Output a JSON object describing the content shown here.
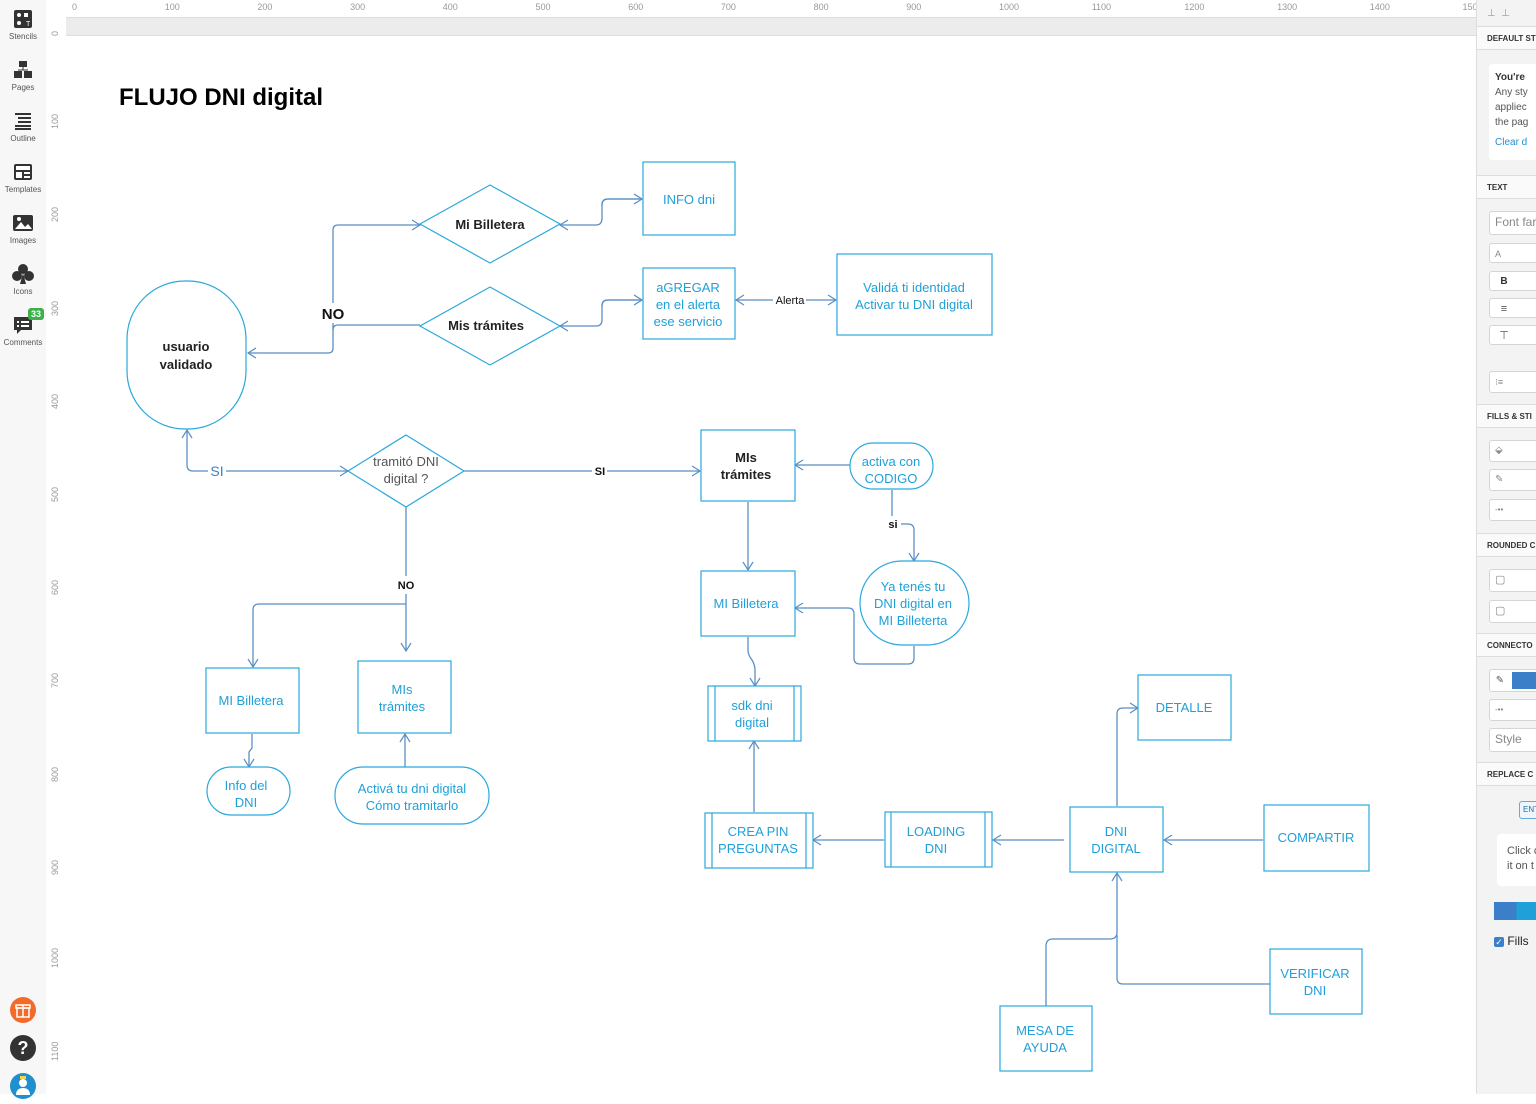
{
  "left_toolbar": {
    "items": [
      {
        "label": "Stencils",
        "icon": "stencils-icon"
      },
      {
        "label": "Pages",
        "icon": "pages-icon"
      },
      {
        "label": "Outline",
        "icon": "outline-icon"
      },
      {
        "label": "Templates",
        "icon": "templates-icon"
      },
      {
        "label": "Images",
        "icon": "images-icon"
      },
      {
        "label": "Icons",
        "icon": "club-icon"
      },
      {
        "label": "Comments",
        "icon": "comments-icon",
        "badge": "33"
      }
    ],
    "bottom": [
      {
        "icon": "gift-icon",
        "color": "#f26b2a"
      },
      {
        "icon": "help-icon",
        "label": "?",
        "color": "#333333"
      },
      {
        "icon": "avatar-icon",
        "color": "#1f8fd0"
      }
    ]
  },
  "rulers": {
    "horizontal": [
      "0",
      "100",
      "200",
      "300",
      "400",
      "500",
      "600",
      "700",
      "800",
      "900",
      "1000",
      "1100",
      "1200",
      "1300",
      "1400",
      "150"
    ],
    "vertical": [
      "0",
      "100",
      "200",
      "300",
      "400",
      "500",
      "600",
      "700",
      "800",
      "900",
      "1000",
      "1100"
    ]
  },
  "diagram": {
    "title": "FLUJO  DNI digital",
    "nodes": {
      "usuario": [
        "usuario",
        "validado"
      ],
      "mi_billetera_d": [
        "Mi Billetera"
      ],
      "mis_tramites_d": [
        "Mis trámites"
      ],
      "info_dni": [
        "INFO dni"
      ],
      "agregar": [
        "aGREGAR",
        "en el alerta",
        "ese servicio"
      ],
      "valida": [
        "Validá ti identidad",
        "Activar tu DNI digital"
      ],
      "tramito": [
        "tramitó DNI",
        "digital ?"
      ],
      "mis_tramites_box": [
        "MIs",
        "trámites"
      ],
      "activa_codigo": [
        "activa con",
        "CODIGO"
      ],
      "mi_billetera_box": [
        "MI Billetera"
      ],
      "ya_tenes": [
        "Ya tenés tu",
        "DNI digital en",
        "MI Billeterta"
      ],
      "sdk": [
        "sdk dni",
        "digital"
      ],
      "mi_billetera_left": [
        "MI Billetera"
      ],
      "mis_tramites_left": [
        "MIs",
        "trámites"
      ],
      "info_del_dni": [
        "Info del",
        "DNI"
      ],
      "activa_dni": [
        "Activá tu dni digital",
        "Cómo tramitarlo"
      ],
      "crea_pin": [
        "CREA PIN",
        "PREGUNTAS"
      ],
      "loading": [
        "LOADING",
        "DNI"
      ],
      "dni_digital": [
        "DNI",
        "DIGITAL"
      ],
      "detalle": [
        "DETALLE"
      ],
      "compartir": [
        "COMPARTIR"
      ],
      "verificar": [
        "VERIFICAR",
        "DNI"
      ],
      "mesa": [
        "MESA DE",
        "AYUDA"
      ]
    },
    "edge_labels": {
      "no_top": "NO",
      "si_left": "SI",
      "si_right": "SI",
      "no_down": "NO",
      "alerta": "Alerta",
      "si_small": "si"
    },
    "colors": {
      "node_stroke": "#2aa8dc",
      "edge_stroke": "#5b8ec4",
      "node_text": "#1fa0d8"
    }
  },
  "right_panel": {
    "sections": [
      "DEFAULT ST",
      "TEXT",
      "FILLS & STI",
      "ROUNDED C",
      "CONNECTO",
      "REPLACE C"
    ],
    "default_style_card": [
      "You're",
      "Any sty",
      "appliec",
      "the pag"
    ],
    "clear_link": "Clear d",
    "font_family_placeholder": "Font far",
    "font_size_prefix": "A",
    "bold_label": "B",
    "style_placeholder": "Style",
    "enter_button": "ENT",
    "hint_card": [
      "Click c",
      "it on t"
    ],
    "fills_checkbox_label": "Fills",
    "fills_checked": true,
    "connector_color": "#3a7fc8"
  }
}
